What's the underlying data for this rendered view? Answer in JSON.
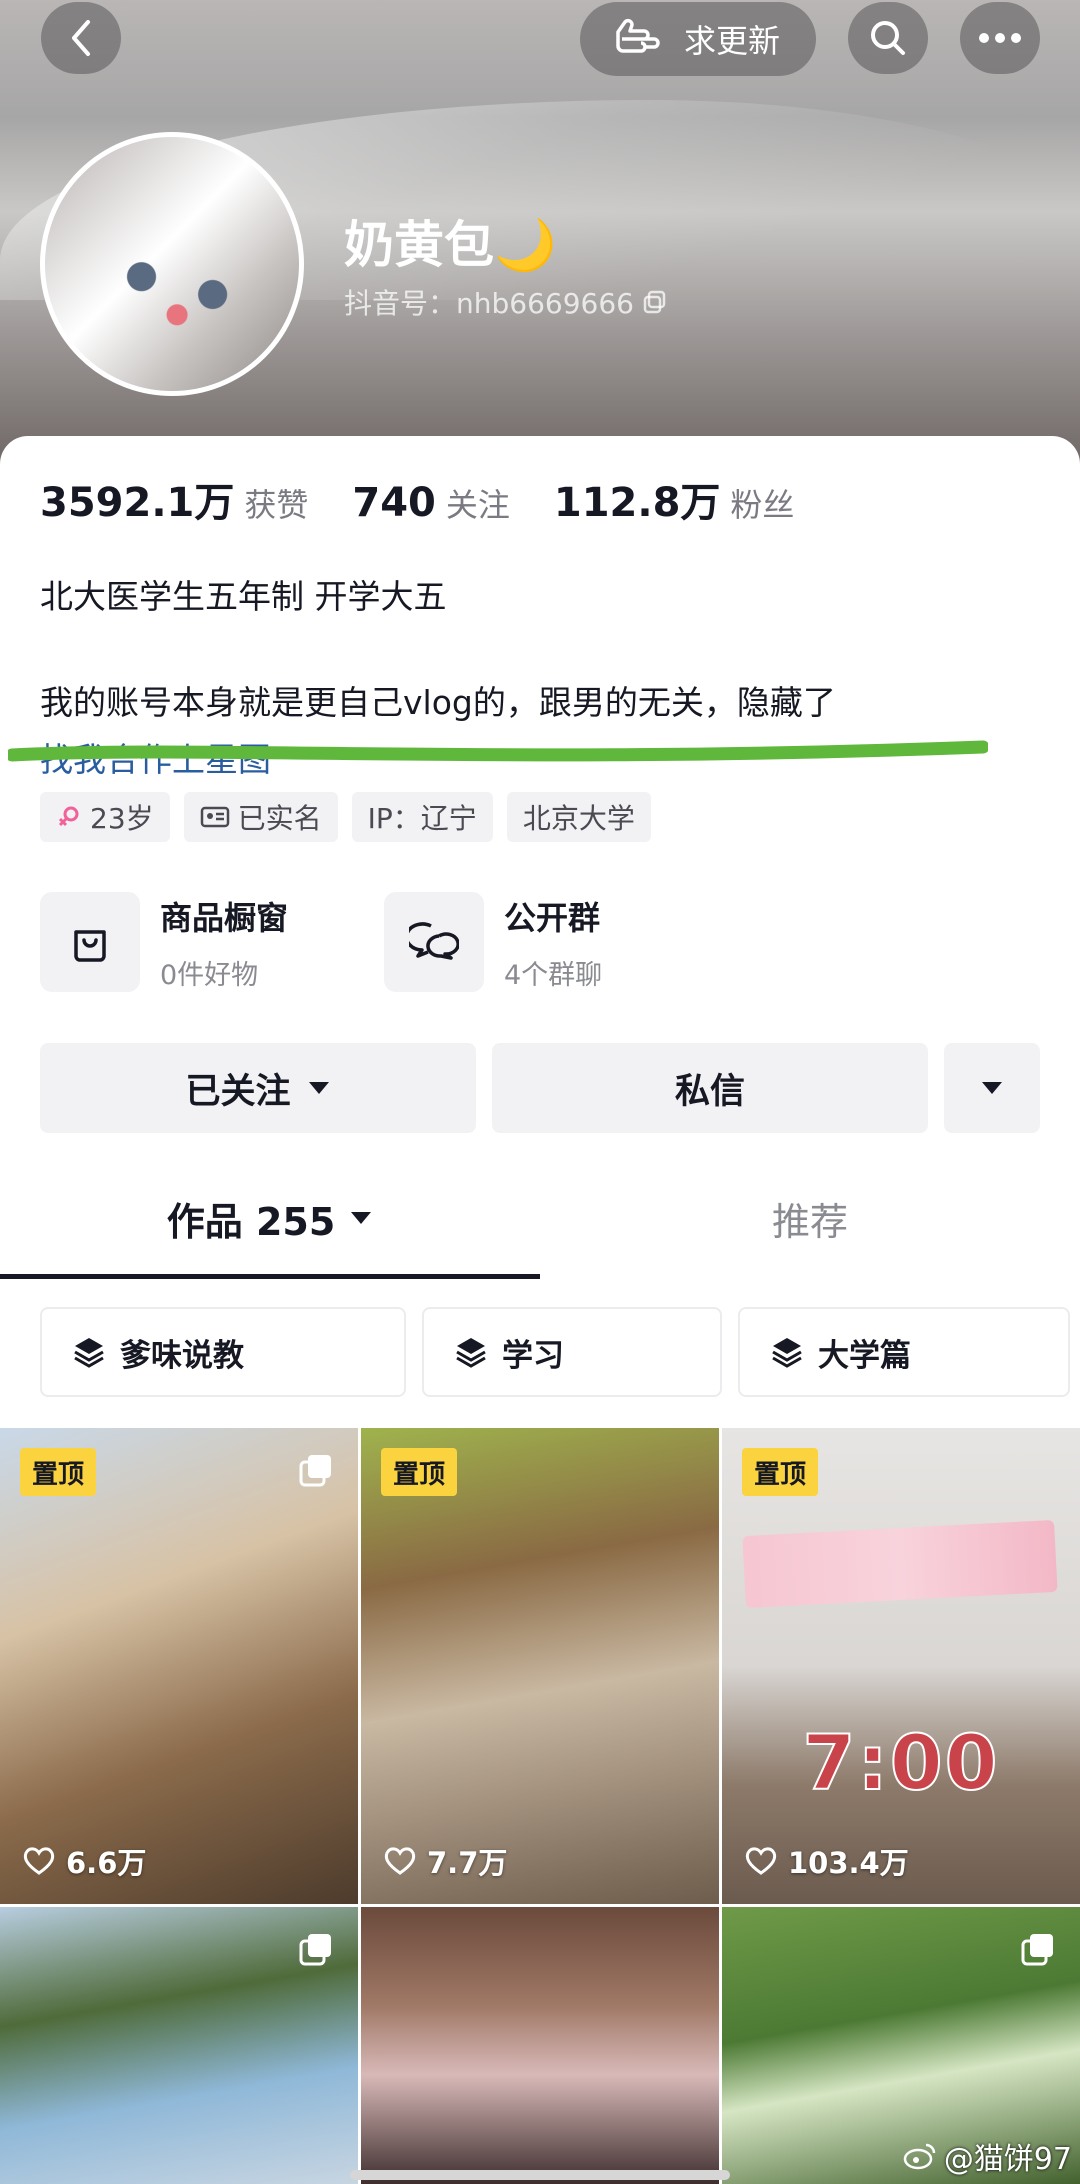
{
  "header": {
    "request_update_label": "求更新",
    "name": "奶黄包🌙",
    "douyin_id": "抖音号：nhb6669666"
  },
  "stats": [
    {
      "value": "3592.1万",
      "label": "获赞"
    },
    {
      "value": "740",
      "label": "关注"
    },
    {
      "value": "112.8万",
      "label": "粉丝"
    }
  ],
  "bio": {
    "line1": "北大医学生五年制  开学大五",
    "line2": "我的账号本身就是更自己vlog的，跟男的无关，隐藏了",
    "line3": "找我合作上星图"
  },
  "tags": [
    "23岁",
    "已实名",
    "IP：辽宁",
    "北京大学"
  ],
  "features": [
    {
      "title": "商品橱窗",
      "sub": "0件好物"
    },
    {
      "title": "公开群",
      "sub": "4个群聊"
    }
  ],
  "actions": {
    "followed": "已关注",
    "message": "私信"
  },
  "tabs": {
    "works": "作品 255",
    "recommend": "推荐"
  },
  "filters": [
    "爹味说教",
    "学习",
    "大学篇"
  ],
  "posts": [
    {
      "pinned": "置顶",
      "likes": "6.6万",
      "multi": true
    },
    {
      "pinned": "置顶",
      "likes": "7.7万",
      "multi": false
    },
    {
      "pinned": "置顶",
      "likes": "103.4万",
      "multi": false,
      "overlay": "7:00"
    },
    {
      "pinned": "",
      "likes": "",
      "multi": true
    },
    {
      "pinned": "",
      "likes": "",
      "multi": false
    },
    {
      "pinned": "",
      "likes": "",
      "multi": true
    }
  ],
  "watermark": "@猫饼97",
  "colors": {
    "pin": "#fad33f",
    "link": "#2a5d9f",
    "highlight": "#5fb83b"
  }
}
